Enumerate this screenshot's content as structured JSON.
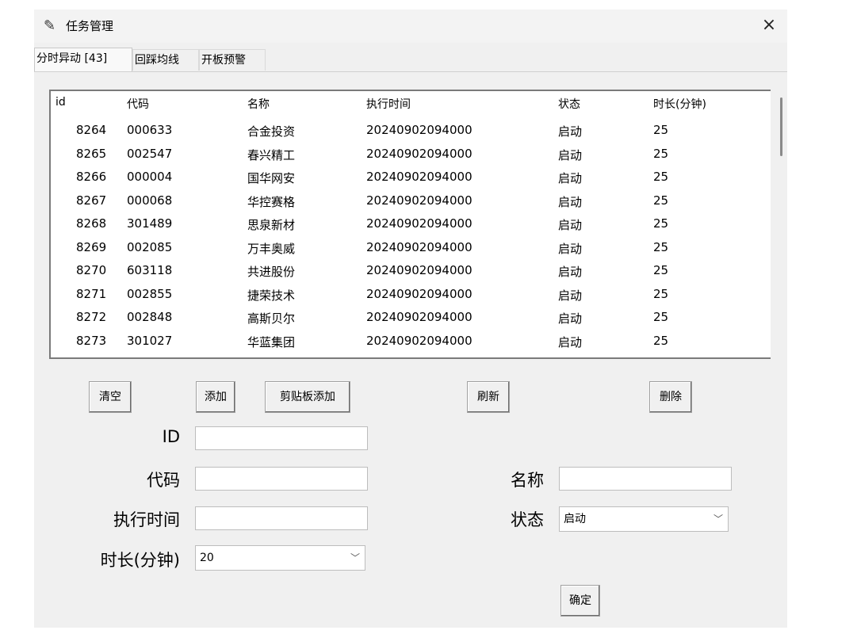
{
  "window": {
    "title": "任务管理",
    "close_glyph": "×"
  },
  "tabs": [
    {
      "label": "分时异动 [43]",
      "active": true
    },
    {
      "label": "回踩均线",
      "active": false
    },
    {
      "label": "开板预警",
      "active": false
    }
  ],
  "table": {
    "columns": [
      "id",
      "代码",
      "名称",
      "执行时间",
      "状态",
      "时长(分钟)"
    ],
    "rows": [
      [
        "8264",
        "000633",
        "合金投资",
        "20240902094000",
        "启动",
        "25"
      ],
      [
        "8265",
        "002547",
        "春兴精工",
        "20240902094000",
        "启动",
        "25"
      ],
      [
        "8266",
        "000004",
        "国华网安",
        "20240902094000",
        "启动",
        "25"
      ],
      [
        "8267",
        "000068",
        "华控赛格",
        "20240902094000",
        "启动",
        "25"
      ],
      [
        "8268",
        "301489",
        "思泉新材",
        "20240902094000",
        "启动",
        "25"
      ],
      [
        "8269",
        "002085",
        "万丰奥威",
        "20240902094000",
        "启动",
        "25"
      ],
      [
        "8270",
        "603118",
        "共进股份",
        "20240902094000",
        "启动",
        "25"
      ],
      [
        "8271",
        "002855",
        "捷荣技术",
        "20240902094000",
        "启动",
        "25"
      ],
      [
        "8272",
        "002848",
        "高斯贝尔",
        "20240902094000",
        "启动",
        "25"
      ],
      [
        "8273",
        "301027",
        "华蓝集团",
        "20240902094000",
        "启动",
        "25"
      ]
    ]
  },
  "buttons": {
    "clear": "清空",
    "add": "添加",
    "paste_add": "剪贴板添加",
    "refresh": "刷新",
    "delete": "删除",
    "confirm": "确定"
  },
  "form": {
    "id_label": "ID",
    "code_label": "代码",
    "name_label": "名称",
    "exec_time_label": "执行时间",
    "status_label": "状态",
    "duration_label": "时长(分钟)",
    "id_value": "",
    "code_value": "",
    "name_value": "",
    "exec_time_value": "",
    "status_value": "启动",
    "duration_value": "20"
  },
  "icons": {
    "app": "feather-icon",
    "close": "close-icon",
    "dropdown": "chevron-down-icon"
  }
}
